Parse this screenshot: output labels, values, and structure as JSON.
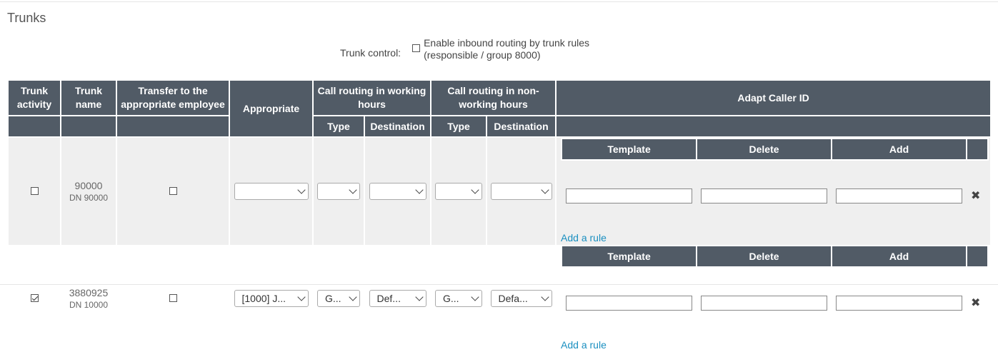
{
  "page": {
    "title": "Trunks"
  },
  "trunk_control": {
    "label": "Trunk control:",
    "option_line1": "Enable inbound routing by trunk rules",
    "option_line2": "(responsible / group 8000)",
    "checked": false
  },
  "table": {
    "headers": {
      "activity": "Trunk activity",
      "name": "Trunk name",
      "transfer": "Transfer to the appropriate employee",
      "appropriate": "Appropriate",
      "working": "Call routing in working hours",
      "nonworking": "Call routing in non-working hours",
      "adapt": "Adapt Caller ID"
    },
    "subheaders": {
      "type": "Type",
      "destination": "Destination",
      "type2": "Type",
      "destination2": "Destination"
    },
    "rows": [
      {
        "active": false,
        "number": "90000",
        "dn": "DN 90000",
        "transfer": false,
        "appropriate": "",
        "work_type": "",
        "work_dest": "",
        "nonwork_type": "",
        "nonwork_dest": "",
        "caller": {
          "template": "Template",
          "delete": "Delete",
          "add": "Add",
          "add_rule": "Add a rule"
        }
      },
      {
        "active": true,
        "number": "3880925",
        "dn": "DN 10000",
        "transfer": false,
        "appropriate": "[1000] J...",
        "work_type": "G...",
        "work_dest": "Def...",
        "nonwork_type": "G...",
        "nonwork_dest": "Defa...",
        "caller": {
          "template": "Template",
          "delete": "Delete",
          "add": "Add",
          "add_rule": "Add a rule"
        }
      }
    ]
  },
  "icons": {
    "remove": "close-icon",
    "dropdown": "chevron-down-icon"
  },
  "colors": {
    "header_bg": "#515b66",
    "link": "#1a8fc0",
    "row_alt_bg": "#efefef"
  }
}
